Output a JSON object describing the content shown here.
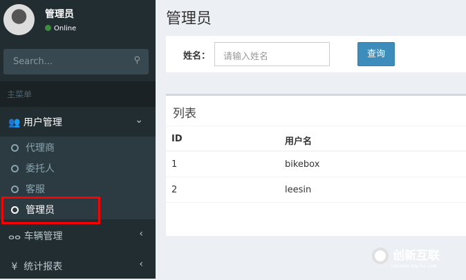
{
  "user": {
    "name": "管理员",
    "status": "Online"
  },
  "search": {
    "placeholder": "Search..."
  },
  "sidebar": {
    "header": "主菜单",
    "groups": [
      {
        "label": "用户管理",
        "children": [
          "代理商",
          "委托人",
          "客服",
          "管理员"
        ]
      },
      {
        "label": "车辆管理"
      },
      {
        "label": "统计报表"
      }
    ]
  },
  "page": {
    "title": "管理员",
    "filter_label": "姓名：",
    "filter_placeholder": "请输入姓名",
    "query_button": "查询"
  },
  "list": {
    "title": "列表",
    "columns": [
      "ID",
      "用户名"
    ],
    "rows": [
      [
        "1",
        "bikebox"
      ],
      [
        "2",
        "leesin"
      ]
    ]
  },
  "watermark": {
    "text": "创新互联",
    "sub": "CHUANG XIN HU LIAN"
  },
  "colors": {
    "sidebar": "#222d32",
    "accent": "#3c8dbc",
    "highlight": "#ff0000"
  }
}
